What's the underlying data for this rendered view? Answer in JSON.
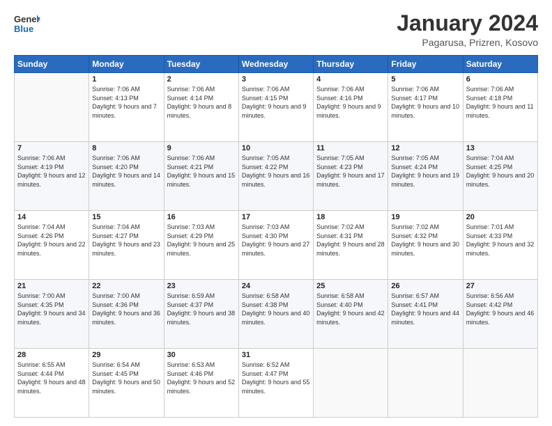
{
  "logo": {
    "general": "General",
    "blue": "Blue"
  },
  "header": {
    "title": "January 2024",
    "subtitle": "Pagarusa, Prizren, Kosovo"
  },
  "weekdays": [
    "Sunday",
    "Monday",
    "Tuesday",
    "Wednesday",
    "Thursday",
    "Friday",
    "Saturday"
  ],
  "weeks": [
    [
      {
        "day": "",
        "sunrise": "",
        "sunset": "",
        "daylight": ""
      },
      {
        "day": "1",
        "sunrise": "Sunrise: 7:06 AM",
        "sunset": "Sunset: 4:13 PM",
        "daylight": "Daylight: 9 hours and 7 minutes."
      },
      {
        "day": "2",
        "sunrise": "Sunrise: 7:06 AM",
        "sunset": "Sunset: 4:14 PM",
        "daylight": "Daylight: 9 hours and 8 minutes."
      },
      {
        "day": "3",
        "sunrise": "Sunrise: 7:06 AM",
        "sunset": "Sunset: 4:15 PM",
        "daylight": "Daylight: 9 hours and 9 minutes."
      },
      {
        "day": "4",
        "sunrise": "Sunrise: 7:06 AM",
        "sunset": "Sunset: 4:16 PM",
        "daylight": "Daylight: 9 hours and 9 minutes."
      },
      {
        "day": "5",
        "sunrise": "Sunrise: 7:06 AM",
        "sunset": "Sunset: 4:17 PM",
        "daylight": "Daylight: 9 hours and 10 minutes."
      },
      {
        "day": "6",
        "sunrise": "Sunrise: 7:06 AM",
        "sunset": "Sunset: 4:18 PM",
        "daylight": "Daylight: 9 hours and 11 minutes."
      }
    ],
    [
      {
        "day": "7",
        "sunrise": "Sunrise: 7:06 AM",
        "sunset": "Sunset: 4:19 PM",
        "daylight": "Daylight: 9 hours and 12 minutes."
      },
      {
        "day": "8",
        "sunrise": "Sunrise: 7:06 AM",
        "sunset": "Sunset: 4:20 PM",
        "daylight": "Daylight: 9 hours and 14 minutes."
      },
      {
        "day": "9",
        "sunrise": "Sunrise: 7:06 AM",
        "sunset": "Sunset: 4:21 PM",
        "daylight": "Daylight: 9 hours and 15 minutes."
      },
      {
        "day": "10",
        "sunrise": "Sunrise: 7:05 AM",
        "sunset": "Sunset: 4:22 PM",
        "daylight": "Daylight: 9 hours and 16 minutes."
      },
      {
        "day": "11",
        "sunrise": "Sunrise: 7:05 AM",
        "sunset": "Sunset: 4:23 PM",
        "daylight": "Daylight: 9 hours and 17 minutes."
      },
      {
        "day": "12",
        "sunrise": "Sunrise: 7:05 AM",
        "sunset": "Sunset: 4:24 PM",
        "daylight": "Daylight: 9 hours and 19 minutes."
      },
      {
        "day": "13",
        "sunrise": "Sunrise: 7:04 AM",
        "sunset": "Sunset: 4:25 PM",
        "daylight": "Daylight: 9 hours and 20 minutes."
      }
    ],
    [
      {
        "day": "14",
        "sunrise": "Sunrise: 7:04 AM",
        "sunset": "Sunset: 4:26 PM",
        "daylight": "Daylight: 9 hours and 22 minutes."
      },
      {
        "day": "15",
        "sunrise": "Sunrise: 7:04 AM",
        "sunset": "Sunset: 4:27 PM",
        "daylight": "Daylight: 9 hours and 23 minutes."
      },
      {
        "day": "16",
        "sunrise": "Sunrise: 7:03 AM",
        "sunset": "Sunset: 4:29 PM",
        "daylight": "Daylight: 9 hours and 25 minutes."
      },
      {
        "day": "17",
        "sunrise": "Sunrise: 7:03 AM",
        "sunset": "Sunset: 4:30 PM",
        "daylight": "Daylight: 9 hours and 27 minutes."
      },
      {
        "day": "18",
        "sunrise": "Sunrise: 7:02 AM",
        "sunset": "Sunset: 4:31 PM",
        "daylight": "Daylight: 9 hours and 28 minutes."
      },
      {
        "day": "19",
        "sunrise": "Sunrise: 7:02 AM",
        "sunset": "Sunset: 4:32 PM",
        "daylight": "Daylight: 9 hours and 30 minutes."
      },
      {
        "day": "20",
        "sunrise": "Sunrise: 7:01 AM",
        "sunset": "Sunset: 4:33 PM",
        "daylight": "Daylight: 9 hours and 32 minutes."
      }
    ],
    [
      {
        "day": "21",
        "sunrise": "Sunrise: 7:00 AM",
        "sunset": "Sunset: 4:35 PM",
        "daylight": "Daylight: 9 hours and 34 minutes."
      },
      {
        "day": "22",
        "sunrise": "Sunrise: 7:00 AM",
        "sunset": "Sunset: 4:36 PM",
        "daylight": "Daylight: 9 hours and 36 minutes."
      },
      {
        "day": "23",
        "sunrise": "Sunrise: 6:59 AM",
        "sunset": "Sunset: 4:37 PM",
        "daylight": "Daylight: 9 hours and 38 minutes."
      },
      {
        "day": "24",
        "sunrise": "Sunrise: 6:58 AM",
        "sunset": "Sunset: 4:38 PM",
        "daylight": "Daylight: 9 hours and 40 minutes."
      },
      {
        "day": "25",
        "sunrise": "Sunrise: 6:58 AM",
        "sunset": "Sunset: 4:40 PM",
        "daylight": "Daylight: 9 hours and 42 minutes."
      },
      {
        "day": "26",
        "sunrise": "Sunrise: 6:57 AM",
        "sunset": "Sunset: 4:41 PM",
        "daylight": "Daylight: 9 hours and 44 minutes."
      },
      {
        "day": "27",
        "sunrise": "Sunrise: 6:56 AM",
        "sunset": "Sunset: 4:42 PM",
        "daylight": "Daylight: 9 hours and 46 minutes."
      }
    ],
    [
      {
        "day": "28",
        "sunrise": "Sunrise: 6:55 AM",
        "sunset": "Sunset: 4:44 PM",
        "daylight": "Daylight: 9 hours and 48 minutes."
      },
      {
        "day": "29",
        "sunrise": "Sunrise: 6:54 AM",
        "sunset": "Sunset: 4:45 PM",
        "daylight": "Daylight: 9 hours and 50 minutes."
      },
      {
        "day": "30",
        "sunrise": "Sunrise: 6:53 AM",
        "sunset": "Sunset: 4:46 PM",
        "daylight": "Daylight: 9 hours and 52 minutes."
      },
      {
        "day": "31",
        "sunrise": "Sunrise: 6:52 AM",
        "sunset": "Sunset: 4:47 PM",
        "daylight": "Daylight: 9 hours and 55 minutes."
      },
      {
        "day": "",
        "sunrise": "",
        "sunset": "",
        "daylight": ""
      },
      {
        "day": "",
        "sunrise": "",
        "sunset": "",
        "daylight": ""
      },
      {
        "day": "",
        "sunrise": "",
        "sunset": "",
        "daylight": ""
      }
    ]
  ]
}
